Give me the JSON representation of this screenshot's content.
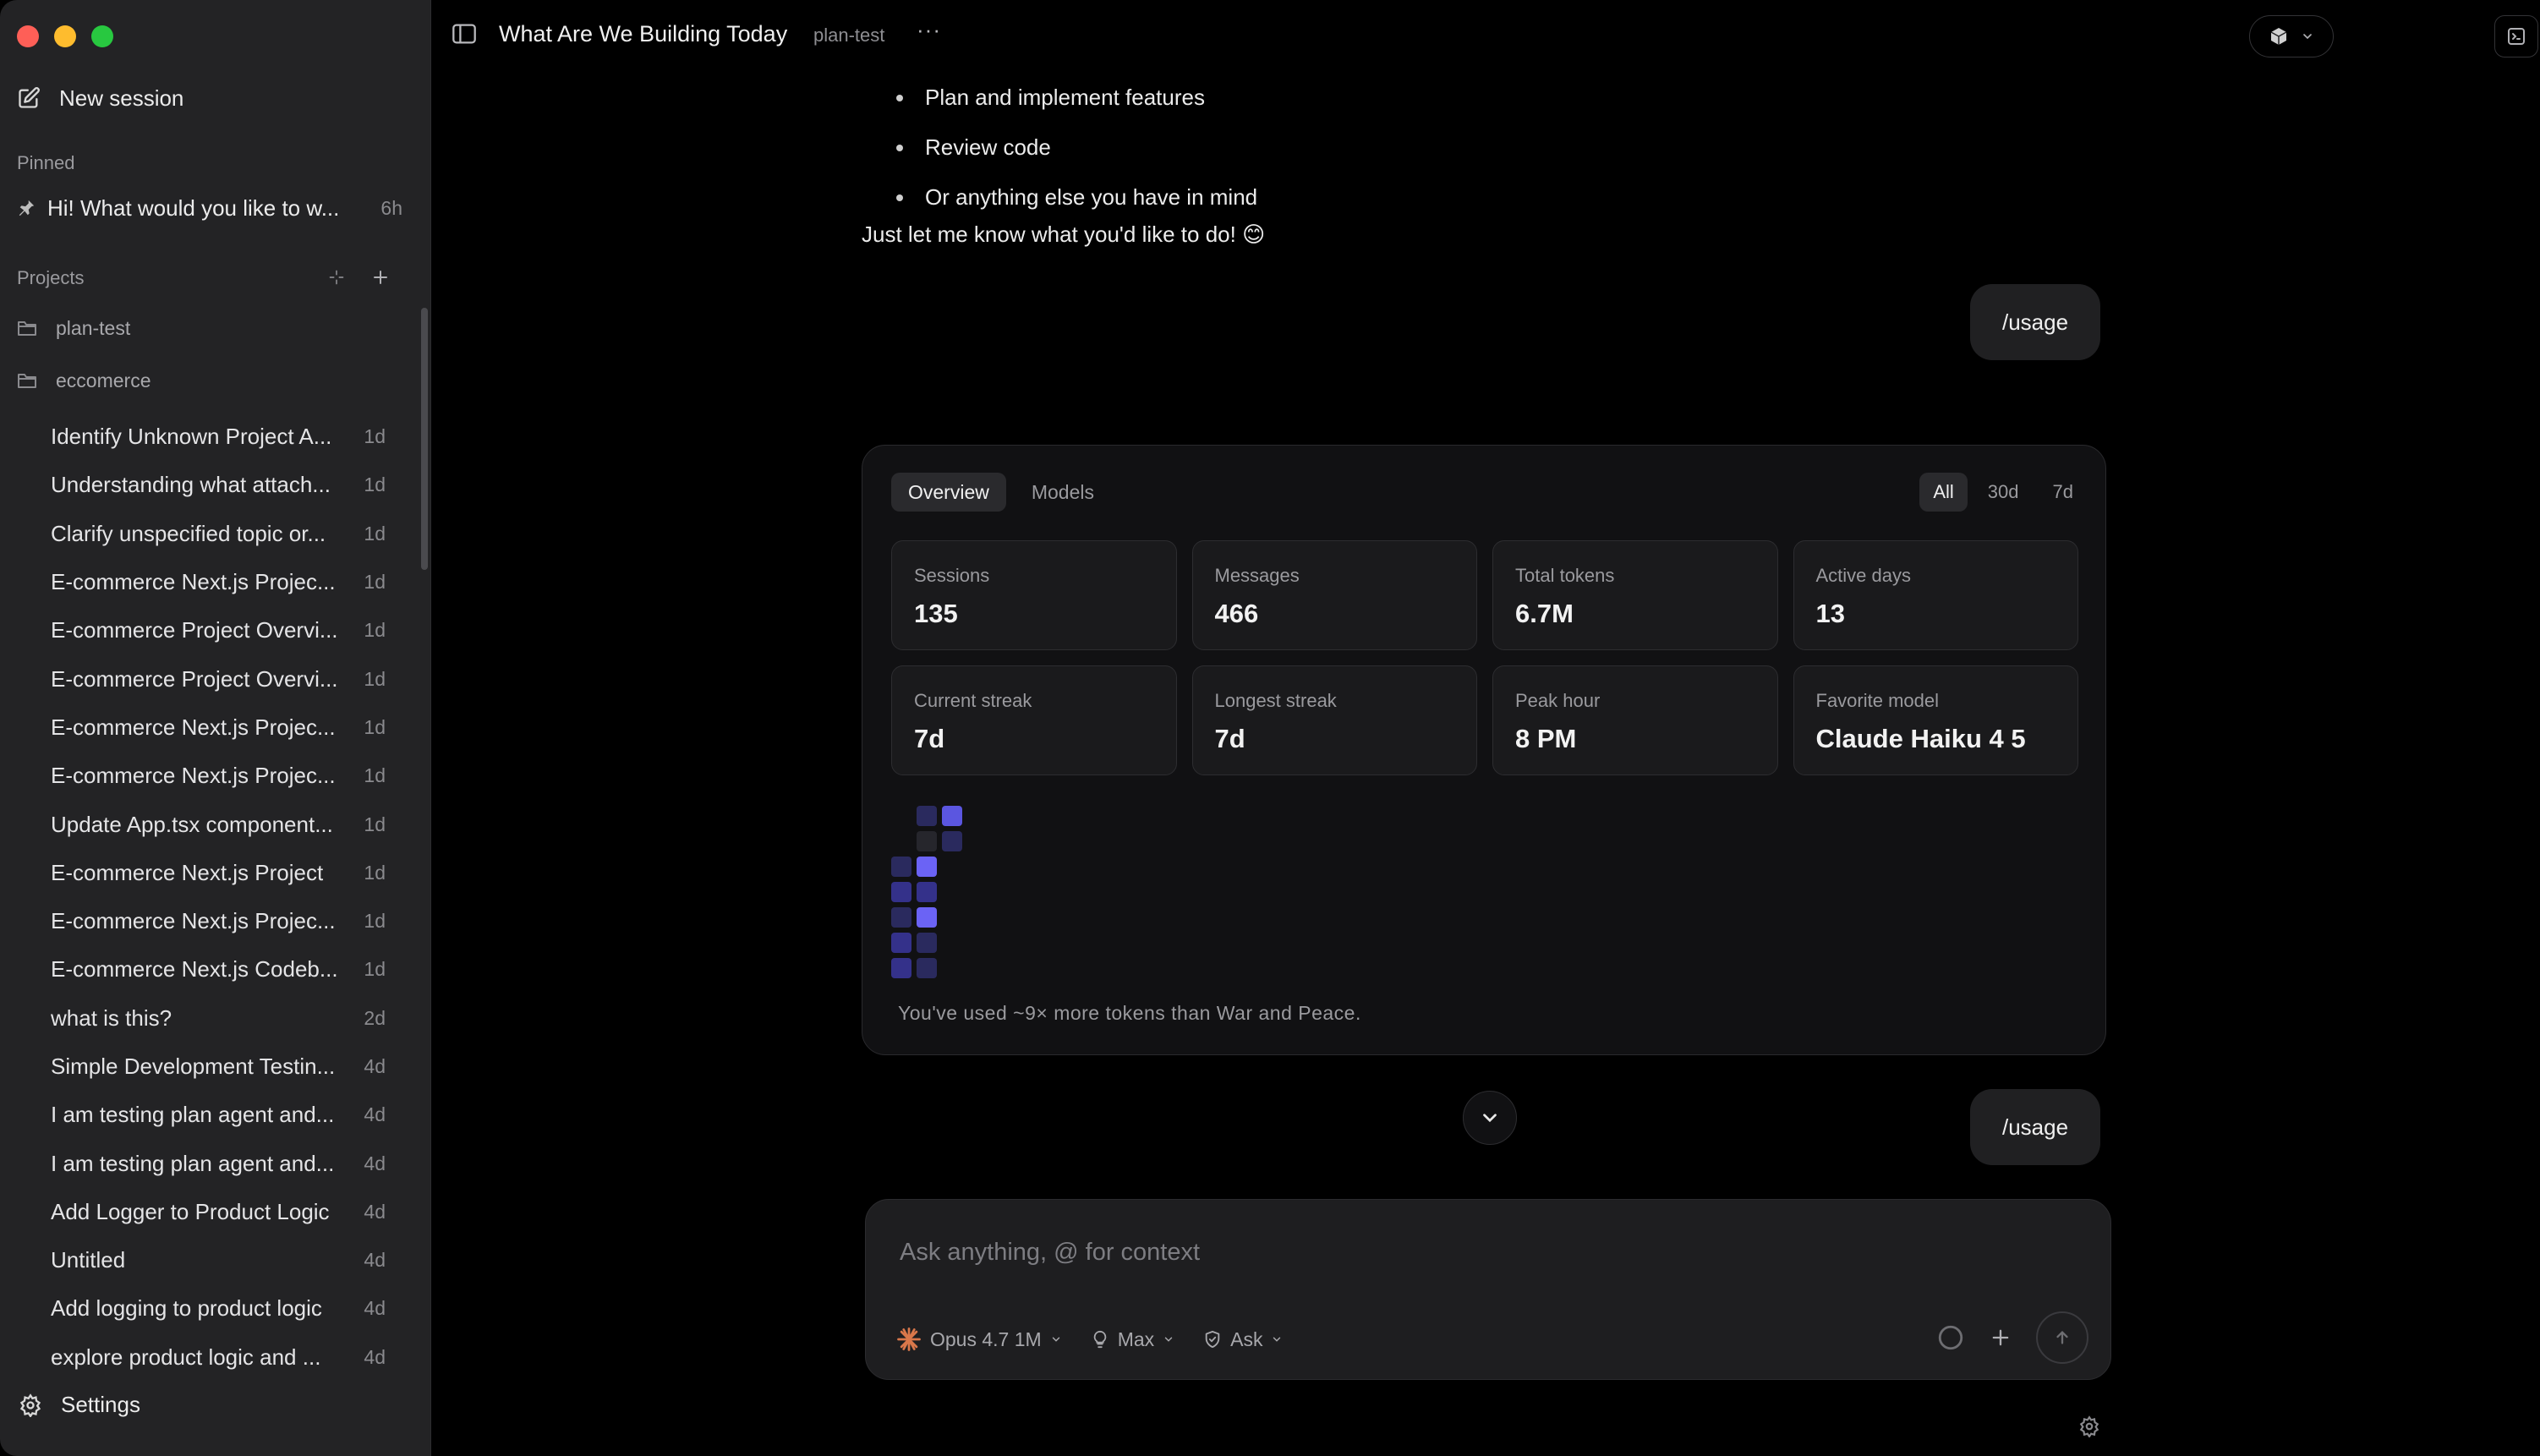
{
  "sidebar": {
    "new_session": "New session",
    "pinned_label": "Pinned",
    "pinned": {
      "title": "Hi! What would you like to w...",
      "age": "6h"
    },
    "projects_label": "Projects",
    "folders": [
      "plan-test",
      "eccomerce"
    ],
    "sessions": [
      {
        "title": "Identify Unknown Project A...",
        "age": "1d"
      },
      {
        "title": "Understanding what attach...",
        "age": "1d"
      },
      {
        "title": "Clarify unspecified topic or...",
        "age": "1d"
      },
      {
        "title": "E-commerce Next.js Projec...",
        "age": "1d"
      },
      {
        "title": "E-commerce Project Overvi...",
        "age": "1d"
      },
      {
        "title": "E-commerce Project Overvi...",
        "age": "1d"
      },
      {
        "title": "E-commerce Next.js Projec...",
        "age": "1d"
      },
      {
        "title": "E-commerce Next.js Projec...",
        "age": "1d"
      },
      {
        "title": "Update App.tsx component...",
        "age": "1d"
      },
      {
        "title": "E-commerce Next.js Project",
        "age": "1d"
      },
      {
        "title": "E-commerce Next.js Projec...",
        "age": "1d"
      },
      {
        "title": "E-commerce Next.js Codeb...",
        "age": "1d"
      },
      {
        "title": "what is this?",
        "age": "2d"
      },
      {
        "title": "Simple Development Testin...",
        "age": "4d"
      },
      {
        "title": "I am testing plan agent and...",
        "age": "4d"
      },
      {
        "title": "I am testing plan agent and...",
        "age": "4d"
      },
      {
        "title": "Add Logger to Product Logic",
        "age": "4d"
      },
      {
        "title": "Untitled",
        "age": "4d"
      },
      {
        "title": "Add logging to product logic",
        "age": "4d"
      },
      {
        "title": "explore product logic and ...",
        "age": "4d"
      }
    ],
    "settings": "Settings"
  },
  "topbar": {
    "title": "What Are We Building Today",
    "subtitle": "plan-test",
    "more": "···"
  },
  "conversation": {
    "bullets": [
      "Plan and implement features",
      "Review code",
      "Or anything else you have in mind"
    ],
    "closing": "Just let me know what you'd like to do! 😊",
    "user_message_1": "/usage",
    "user_message_2": "/usage"
  },
  "usage": {
    "tabs": [
      "Overview",
      "Models"
    ],
    "ranges": [
      "All",
      "30d",
      "7d"
    ],
    "stats": [
      {
        "label": "Sessions",
        "value": "135"
      },
      {
        "label": "Messages",
        "value": "466"
      },
      {
        "label": "Total tokens",
        "value": "6.7M"
      },
      {
        "label": "Active days",
        "value": "13"
      },
      {
        "label": "Current streak",
        "value": "7d"
      },
      {
        "label": "Longest streak",
        "value": "7d"
      },
      {
        "label": "Peak hour",
        "value": "8 PM"
      },
      {
        "label": "Favorite model",
        "value": "Claude Haiku 4 5"
      }
    ],
    "footer": "You've used ~9× more tokens than War and Peace."
  },
  "composer": {
    "placeholder": "Ask anything, @ for context",
    "model": "Opus 4.7 1M",
    "effort": "Max",
    "mode": "Ask"
  },
  "colors": {
    "accent": "#5b56e0",
    "accent_bright": "#6b63f5",
    "heat_low": "#2a2a5e",
    "heat_none": "#26262c"
  }
}
